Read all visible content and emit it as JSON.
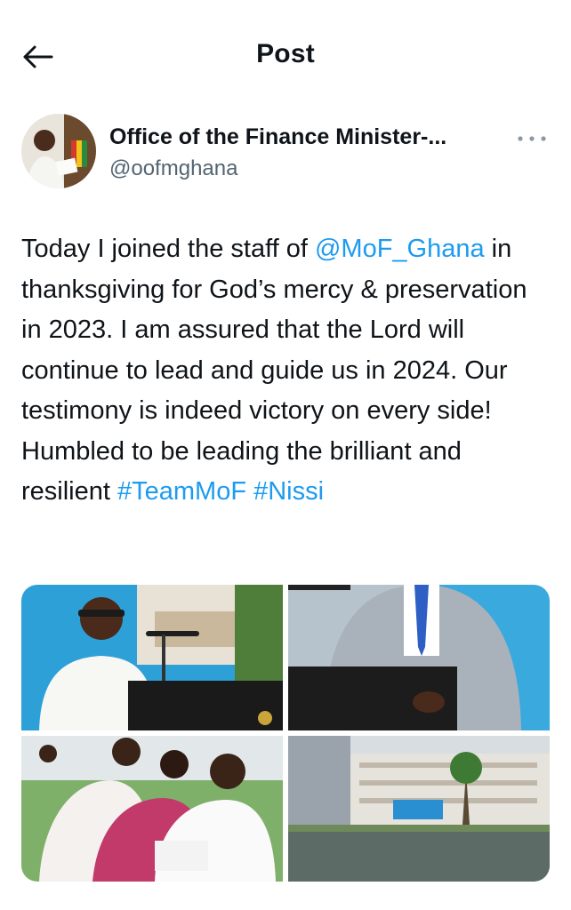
{
  "header": {
    "title": "Post",
    "back_icon": "arrow-left-icon"
  },
  "author": {
    "name": "Office of the Finance Minister-...",
    "handle": "@oofmghana",
    "avatar_icon": "avatar",
    "more_icon": "more-horizontal-icon"
  },
  "tweet": {
    "text_1": "Today I joined the staff of ",
    "mention": "@MoF_Ghana",
    "text_2": " in thanksgiving for God’s mercy & preservation in 2023. I am assured that the Lord will continue to lead and guide us in 2024. Our testimony is indeed victory on every side! Humbled to be leading the brilliant and resilient ",
    "hashtag_1": "#TeamMoF",
    "space": " ",
    "hashtag_2": "#Nissi"
  },
  "media": {
    "count": 4
  },
  "colors": {
    "link": "#1d9bf0",
    "text": "#0f1419",
    "secondary": "#536471"
  }
}
